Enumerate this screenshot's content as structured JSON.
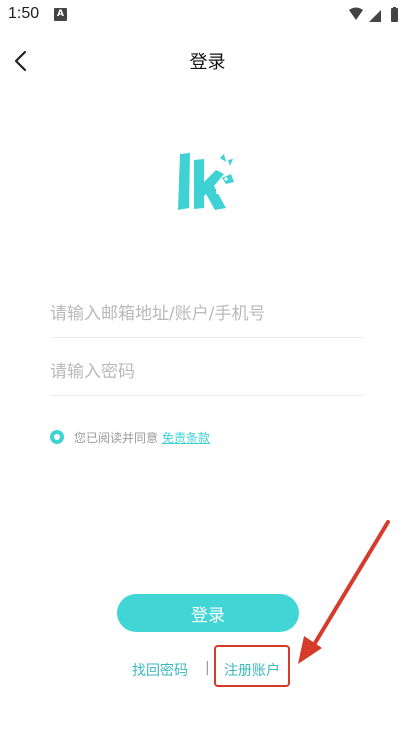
{
  "status_bar": {
    "time": "1:50",
    "app_icon_letter": "A",
    "icons": [
      "wifi-icon",
      "signal-icon",
      "battery-icon"
    ]
  },
  "header": {
    "title": "登录",
    "back_icon": "chevron-left-icon"
  },
  "logo": {
    "name": "lk-logo",
    "color": "#3fd2d4"
  },
  "form": {
    "account_placeholder": "请输入邮箱地址/账户/手机号",
    "password_placeholder": "请输入密码",
    "agree_text": "您已阅读并同意",
    "agree_link": "免责条款",
    "agree_checked": true
  },
  "login_button_label": "登录",
  "links": {
    "forgot": "找回密码",
    "separator": "|",
    "register": "注册账户"
  },
  "colors": {
    "accent": "#41d5d6",
    "link": "#3ab9c0",
    "annotation": "#d63a2b"
  }
}
